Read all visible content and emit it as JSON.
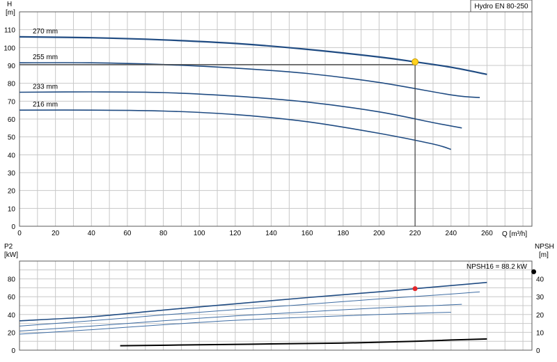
{
  "chart_data": [
    {
      "type": "line",
      "title": "Hydro EN 80-250",
      "xlabel": "Q [m³/h]",
      "ylabel_top": "H",
      "ylabel_unit": "[m]",
      "xlim": [
        0,
        285
      ],
      "ylim": [
        0,
        120
      ],
      "x_ticks": [
        0,
        20,
        40,
        60,
        80,
        100,
        120,
        140,
        160,
        180,
        200,
        220,
        240,
        260
      ],
      "y_ticks": [
        0,
        10,
        20,
        30,
        40,
        50,
        60,
        70,
        80,
        90,
        100,
        110
      ],
      "grid": true,
      "colors": {
        "curve": "#1f4b82",
        "duty": "#404040",
        "marker": "#ffd21f"
      },
      "series": [
        {
          "name": "270 mm",
          "x": [
            0,
            40,
            80,
            120,
            160,
            200,
            220,
            240,
            260
          ],
          "y": [
            106,
            105.5,
            104.3,
            102.3,
            99,
            94.7,
            92,
            89,
            85
          ]
        },
        {
          "name": "255 mm",
          "x": [
            0,
            40,
            80,
            120,
            160,
            200,
            240,
            256
          ],
          "y": [
            91.5,
            91.5,
            90.5,
            88.5,
            85.5,
            80.5,
            73.5,
            72
          ]
        },
        {
          "name": "233 mm",
          "x": [
            0,
            40,
            80,
            120,
            160,
            200,
            230,
            246
          ],
          "y": [
            75,
            75.2,
            74.8,
            72.8,
            69.5,
            64,
            58,
            55
          ]
        },
        {
          "name": "216 mm",
          "x": [
            0,
            40,
            80,
            120,
            160,
            200,
            230,
            240
          ],
          "y": [
            65,
            65,
            64.5,
            62.5,
            58.5,
            52,
            46,
            43
          ]
        }
      ],
      "duty_point": {
        "x": 220,
        "y": 92
      },
      "duty_line_y": 90.5
    },
    {
      "type": "line",
      "ylabel_left_top": "P2",
      "ylabel_left_unit": "[kW]",
      "ylabel_right_top": "NPSH",
      "ylabel_right_unit": "[m]",
      "xlim": [
        0,
        285
      ],
      "ylim": [
        0,
        100
      ],
      "y_ticks": [
        0,
        20,
        40,
        60,
        80
      ],
      "right_ylim": [
        0,
        50
      ],
      "right_y_ticks": [
        0,
        10,
        20,
        30,
        40
      ],
      "annotation": "NPSH16 = 88.2 kW",
      "grid": true,
      "colors": {
        "curve": "#1f4b82",
        "thin": "#3d6ca3",
        "npsh": "#000000",
        "marker": "#e3262a"
      },
      "series": [
        {
          "name": "270 mm",
          "x": [
            0,
            40,
            80,
            120,
            160,
            200,
            220,
            240,
            260
          ],
          "y": [
            33,
            37.5,
            45,
            52,
            59,
            65.5,
            69,
            72.5,
            76
          ]
        },
        {
          "name": "255 mm",
          "x": [
            0,
            40,
            80,
            120,
            160,
            200,
            240,
            256
          ],
          "y": [
            27,
            33,
            39.5,
            45.5,
            51.5,
            57.5,
            63,
            65.5
          ]
        },
        {
          "name": "233 mm",
          "x": [
            0,
            40,
            80,
            120,
            160,
            200,
            230,
            246
          ],
          "y": [
            21.5,
            27,
            33,
            38.5,
            43,
            47.5,
            50,
            51.5
          ]
        },
        {
          "name": "216 mm",
          "x": [
            0,
            40,
            80,
            120,
            160,
            200,
            230,
            240
          ],
          "y": [
            18,
            23,
            28.5,
            33.5,
            37,
            40,
            42,
            42.5
          ]
        }
      ],
      "npsh": {
        "x": [
          56,
          100,
          140,
          180,
          220,
          240,
          260
        ],
        "y": [
          2.5,
          3,
          3.5,
          4,
          5,
          5.7,
          6.3
        ]
      },
      "power_point": {
        "x": 220,
        "y": 69
      },
      "npsh_point": {
        "x": 286,
        "y": 44
      }
    }
  ]
}
